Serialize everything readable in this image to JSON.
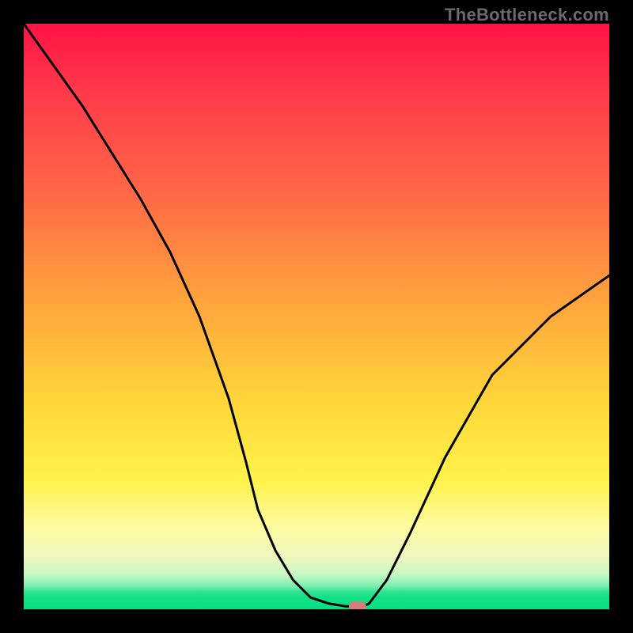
{
  "watermark": "TheBottleneck.com",
  "chart_data": {
    "type": "line",
    "title": "",
    "xlabel": "",
    "ylabel": "",
    "xlim": [
      0,
      100
    ],
    "ylim": [
      0,
      100
    ],
    "grid": false,
    "series": [
      {
        "name": "bottleneck-curve",
        "x": [
          0,
          5,
          10,
          15,
          20,
          25,
          30,
          35,
          38,
          40,
          43,
          46,
          49,
          52,
          55,
          57,
          58,
          59,
          62,
          66,
          72,
          80,
          90,
          100
        ],
        "y": [
          100,
          93,
          86,
          78,
          70,
          61,
          50,
          36,
          25,
          17,
          10,
          5,
          2,
          1,
          0.5,
          0.5,
          0.5,
          1,
          5,
          13,
          26,
          40,
          50,
          57
        ]
      }
    ],
    "marker": {
      "x": 57,
      "y": 0.5,
      "name": "optimal-point"
    },
    "background_gradient": {
      "top": "#ff1445",
      "mid1": "#ffa63c",
      "mid2": "#fff34a",
      "bottom": "#09dd82"
    }
  }
}
